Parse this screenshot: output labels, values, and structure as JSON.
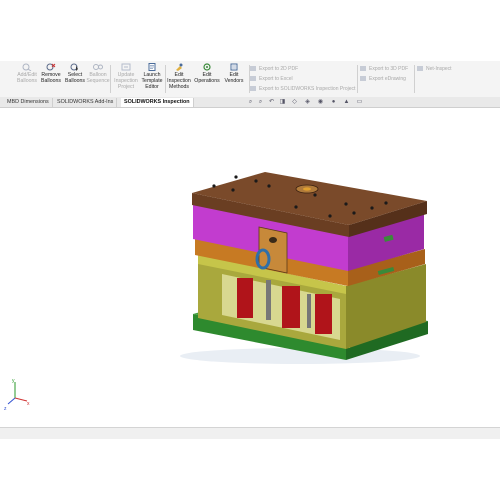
{
  "ribbon": {
    "buttons": [
      {
        "label": "Add/Edit Balloons",
        "enabled": false,
        "icon": "add-balloon-icon"
      },
      {
        "label": "Remove Balloons",
        "enabled": true,
        "icon": "remove-balloon-icon"
      },
      {
        "label": "Select Balloons",
        "enabled": true,
        "icon": "select-balloon-icon"
      },
      {
        "label": "Balloon Sequence",
        "enabled": false,
        "icon": "balloon-sequence-icon"
      },
      {
        "label": "Update Inspection Project",
        "enabled": false,
        "icon": "update-project-icon"
      },
      {
        "label": "Launch Template Editor",
        "enabled": true,
        "icon": "template-editor-icon"
      },
      {
        "label": "Edit Inspection Methods",
        "enabled": true,
        "icon": "inspection-methods-icon"
      },
      {
        "label": "Edit Operations",
        "enabled": true,
        "icon": "operations-icon"
      },
      {
        "label": "Edit Vendors",
        "enabled": true,
        "icon": "vendors-icon"
      }
    ],
    "export_left": [
      "Export to 2D PDF",
      "Export to Excel",
      "Export to SOLIDWORKS Inspection Project"
    ],
    "export_right": [
      "Export to 3D PDF",
      "Export eDrawing"
    ],
    "net_inspect": "Net-Inspect"
  },
  "tabs": [
    {
      "label": "MBD Dimensions",
      "active": false
    },
    {
      "label": "SOLIDWORKS Add-Ins",
      "active": false
    },
    {
      "label": "SOLIDWORKS Inspection",
      "active": true
    }
  ],
  "heads_up_toolbar": [
    "zoom-to-fit-icon",
    "zoom-area-icon",
    "previous-view-icon",
    "section-view-icon",
    "view-orientation-icon",
    "display-style-icon",
    "hide-show-icon",
    "edit-appearance-icon",
    "apply-scene-icon",
    "view-settings-icon"
  ],
  "triad": {
    "x_label": "x",
    "y_label": "y",
    "z_label": "z"
  },
  "colors": {
    "top_plate": "#7a4a2a",
    "cavity_plate": "#c23ccf",
    "orange_plate": "#c77a23",
    "olive_body": "#a9a83d",
    "support_pillars": "#b0141a",
    "base_plate": "#2e8a2e",
    "ejector_plate": "#e8e86a"
  }
}
